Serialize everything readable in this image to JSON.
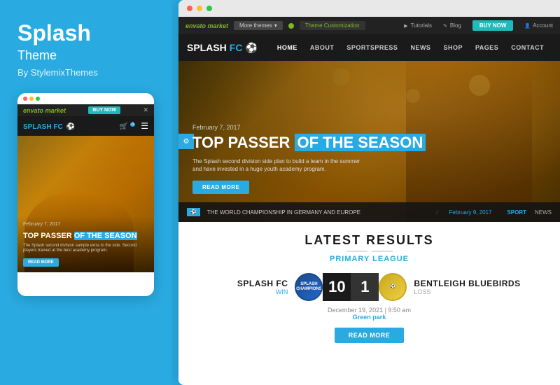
{
  "left": {
    "title": "Splash",
    "subtitle": "Theme",
    "author": "By StylemixThemes",
    "mobile": {
      "envato_logo": "envato market",
      "buy_now": "BUY NOW",
      "logo": "SPLASH FC",
      "date": "February 7, 2017",
      "hero_title_part1": "TOP PASSER ",
      "hero_title_part2": "OF THE SEASON",
      "hero_text": "The Splash second division sample extra to the side. Second players trained at the best academy program.",
      "read_more": "READ MORE"
    }
  },
  "right": {
    "browser": {
      "dots": [
        "red",
        "yellow",
        "green"
      ]
    },
    "topbar": {
      "envato_logo": "envato market",
      "more_themes": "More themes",
      "theme_customization": "Theme Customization",
      "tutorials": "Tutorials",
      "blog": "Blog",
      "buy_now": "BUY NOW",
      "account": "Account"
    },
    "nav": {
      "logo": "SPLASH FC",
      "links": [
        "HOME",
        "ABOUT",
        "SPORTSPRESS",
        "NEWS",
        "SHOP",
        "PAGES",
        "CONTACT"
      ]
    },
    "hero": {
      "date": "February 7, 2017",
      "title_part1": "TOP PASSER",
      "title_part2": "OF THE SEASON",
      "description": "The Splash second division side plan to build a team in the summer and have invested in a huge youth academy program.",
      "read_more": "READ MORE",
      "breaking_label": "⚽",
      "breaking_text": "THE WORLD CHAMPIONSHIP IN GERMANY AND EUROPE",
      "breaking_date": "February 9, 2017",
      "sport_tag": "SPORT",
      "news_tag": "NEWS"
    },
    "results": {
      "title": "LATEST RESULTS",
      "league": "Primary League",
      "home_team": "SPLASH FC",
      "home_status": "WIN",
      "home_score": "10",
      "away_score": "1",
      "away_team": "BENTLEIGH BLUEBIRDS",
      "away_status": "LOSS",
      "match_date": "December 19, 2021 | 9:50 am",
      "match_venue": "Green park",
      "read_more": "READ MORE"
    }
  }
}
